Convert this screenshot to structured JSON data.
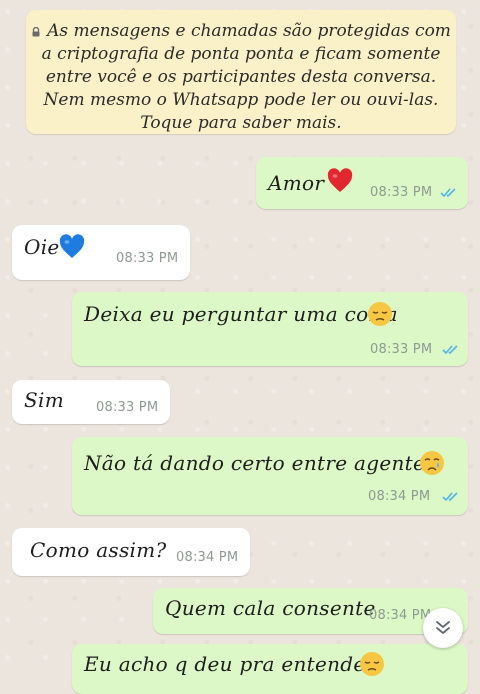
{
  "encryption_notice": {
    "lines": [
      "As mensagens e chamadas são protegidas com",
      "a criptografia de ponta ponta e ficam somente",
      "entre você e os participantes desta conversa.",
      "Nem mesmo o Whatsapp pode ler ou ouvi-las.",
      "Toque para saber mais."
    ]
  },
  "messages": [
    {
      "direction": "outgoing",
      "text": "Amor",
      "emoji": "red-heart",
      "time": "08:33 PM",
      "status": "read"
    },
    {
      "direction": "incoming",
      "text": "Oie",
      "emoji": "blue-heart",
      "time": "08:33 PM"
    },
    {
      "direction": "outgoing",
      "text": "Deixa eu perguntar uma coisa",
      "emoji": "pensive-face",
      "time": "08:33 PM",
      "status": "read"
    },
    {
      "direction": "incoming",
      "text": "Sim",
      "time": "08:33 PM"
    },
    {
      "direction": "outgoing",
      "text": "Não tá dando certo entre agente?",
      "emoji": "crying-face",
      "time": "08:34 PM",
      "status": "read"
    },
    {
      "direction": "incoming",
      "text": "Como assim?",
      "time": "08:34 PM"
    },
    {
      "direction": "outgoing",
      "text": "Quem cala consente",
      "time": "08:34 PM",
      "status": "read"
    },
    {
      "direction": "outgoing",
      "text": "Eu acho q deu pra entender",
      "emoji": "pensive-face",
      "partial": true
    }
  ],
  "colors": {
    "outgoing_bubble": "#dcf8c6",
    "incoming_bubble": "#ffffff",
    "notice_bg": "#fbf1c8",
    "read_ticks": "#4fb6ec",
    "background": "#ece5dd"
  },
  "icons": {
    "scroll_down": "double-chevron-down-icon",
    "lock": "lock-icon"
  }
}
